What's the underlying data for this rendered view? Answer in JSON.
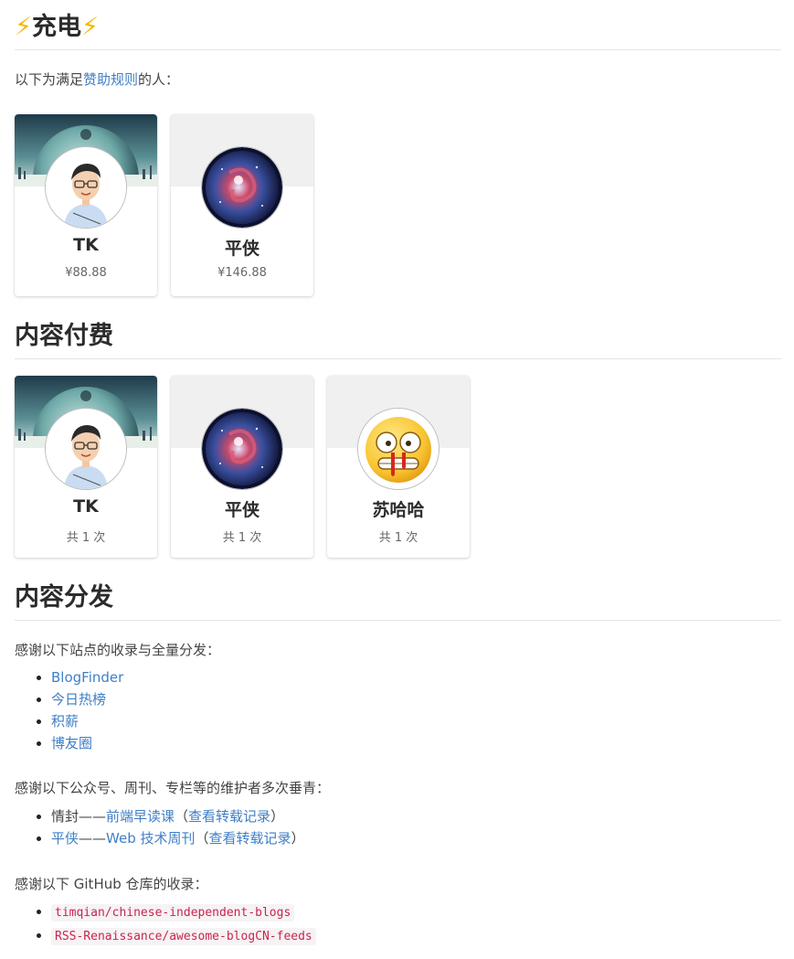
{
  "charging": {
    "title": "充电",
    "intro_before": "以下为满足",
    "intro_link": "赞助规则",
    "intro_after": "的人：",
    "cards": [
      {
        "name": "TK",
        "sub": "¥88.88"
      },
      {
        "name": "平侠",
        "sub": "¥146.88"
      }
    ]
  },
  "paid": {
    "title": "内容付费",
    "cards": [
      {
        "name": "TK",
        "sub": "共 1 次"
      },
      {
        "name": "平侠",
        "sub": "共 1 次"
      },
      {
        "name": "苏哈哈",
        "sub": "共 1 次"
      }
    ]
  },
  "distribution": {
    "title": "内容分发",
    "sites_intro": "感谢以下站点的收录与全量分发：",
    "sites": [
      "BlogFinder",
      "今日热榜",
      "积薪",
      "博友圈"
    ],
    "media_intro": "感谢以下公众号、周刊、专栏等的维护者多次垂青：",
    "media": [
      {
        "person": "情封",
        "sep": "——",
        "outlet": "前端早读课",
        "open": "（",
        "record": "查看转载记录",
        "close": "）",
        "person_is_link": false
      },
      {
        "person": "平侠",
        "sep": "——",
        "outlet": "Web 技术周刊",
        "open": "（",
        "record": "查看转载记录",
        "close": "）",
        "person_is_link": true
      }
    ],
    "github_intro": "感谢以下 GitHub 仓库的收录：",
    "repos": [
      "timqian/chinese-independent-blogs",
      "RSS-Renaissance/awesome-blogCN-feeds"
    ]
  },
  "colors": {
    "link": "#3f7fc6",
    "code_text": "#c7254e",
    "bolt": "#f5b800"
  }
}
